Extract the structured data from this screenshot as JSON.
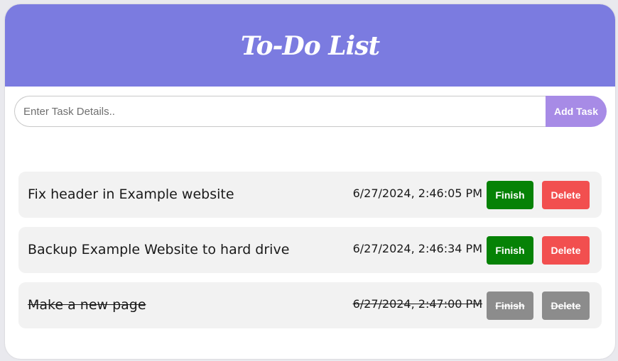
{
  "header": {
    "title": "To-Do List"
  },
  "input": {
    "placeholder": "Enter Task Details..",
    "value": ""
  },
  "add_button": {
    "label": "Add Task"
  },
  "colors": {
    "header_bg": "#7b7be0",
    "add_button": "#a78be6",
    "finish": "#068206",
    "delete": "#f24f4f",
    "disabled": "#8c8c8c"
  },
  "tasks": [
    {
      "text": "Fix header in Example website",
      "timestamp": "6/27/2024, 2:46:05 PM",
      "finish_label": "Finish",
      "delete_label": "Delete",
      "completed": false
    },
    {
      "text": "Backup Example Website to hard drive",
      "timestamp": "6/27/2024, 2:46:34 PM",
      "finish_label": "Finish",
      "delete_label": "Delete",
      "completed": false
    },
    {
      "text": "Make a new page",
      "timestamp": "6/27/2024, 2:47:00 PM",
      "finish_label": "Finish",
      "delete_label": "Delete",
      "completed": true
    }
  ]
}
